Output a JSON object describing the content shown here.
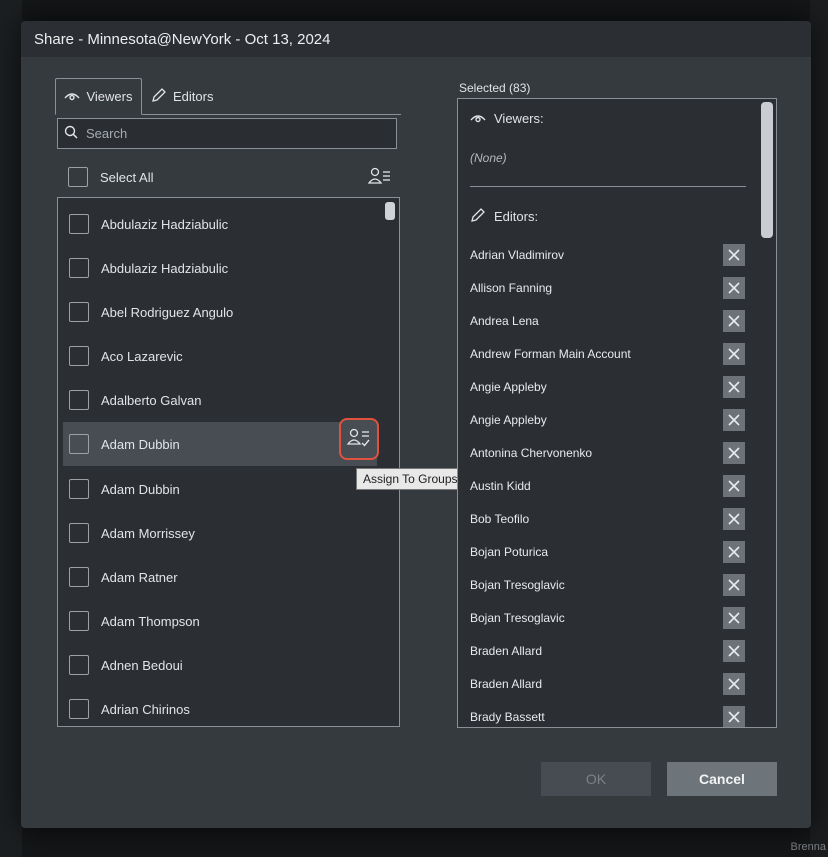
{
  "dialog": {
    "title": "Share - Minnesota@NewYork - Oct 13, 2024"
  },
  "tabs": [
    {
      "label": "Viewers",
      "icon": "eye-icon",
      "active": true
    },
    {
      "label": "Editors",
      "icon": "pencil-icon",
      "active": false
    }
  ],
  "search": {
    "placeholder": "Search",
    "value": ""
  },
  "select_all": {
    "label": "Select All"
  },
  "users": [
    "Abdulaziz Hadziabulic",
    "Abdulaziz Hadziabulic",
    "Abel Rodriguez Angulo",
    "Aco Lazarevic",
    "Adalberto Galvan",
    "Adam Dubbin",
    "Adam Dubbin",
    "Adam Morrissey",
    "Adam Ratner",
    "Adam Thompson",
    "Adnen Bedoui",
    "Adrian Chirinos"
  ],
  "highlighted_user_index": 5,
  "tooltip": "Assign To Groups",
  "selected": {
    "label": "Selected (83)",
    "viewers_header": "Viewers:",
    "viewers_none": "(None)",
    "editors_header": "Editors:",
    "editors": [
      "Adrian Vladimirov",
      "Allison Fanning",
      "Andrea Lena",
      "Andrew Forman Main Account",
      "Angie Appleby",
      "Angie Appleby",
      "Antonina Chervonenko",
      "Austin Kidd",
      "Bob Teofilo",
      "Bojan Poturica",
      "Bojan Tresoglavic",
      "Bojan Tresoglavic",
      "Braden Allard",
      "Braden Allard",
      "Brady Bassett"
    ]
  },
  "buttons": {
    "ok": "OK",
    "cancel": "Cancel"
  },
  "background": {
    "corner_text": "Brenna"
  },
  "colors": {
    "accent_outline": "#e0523e",
    "dialog_bg": "#353a3f"
  }
}
